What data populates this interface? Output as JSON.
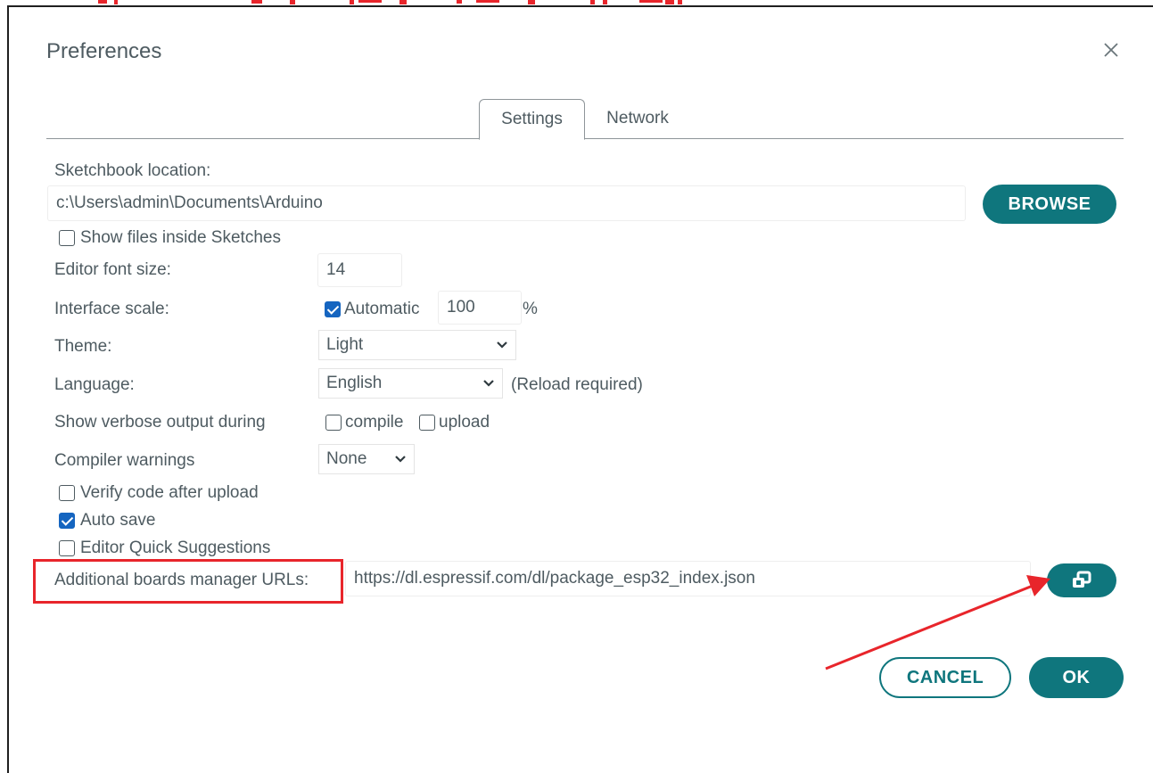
{
  "dialog": {
    "title": "Preferences",
    "tabs": [
      {
        "label": "Settings",
        "active": true
      },
      {
        "label": "Network",
        "active": false
      }
    ]
  },
  "settings": {
    "sketchbook_label": "Sketchbook location:",
    "sketchbook_value": "c:\\Users\\admin\\Documents\\Arduino",
    "browse_label": "BROWSE",
    "show_files_label": "Show files inside Sketches",
    "show_files_checked": false,
    "font_size_label": "Editor font size:",
    "font_size_value": "14",
    "scale_label": "Interface scale:",
    "scale_auto_label": "Automatic",
    "scale_auto_checked": true,
    "scale_value": "100",
    "scale_unit": "%",
    "theme_label": "Theme:",
    "theme_value": "Light",
    "language_label": "Language:",
    "language_value": "English",
    "language_note": "(Reload required)",
    "verbose_label": "Show verbose output during",
    "verbose_compile_label": "compile",
    "verbose_compile_checked": false,
    "verbose_upload_label": "upload",
    "verbose_upload_checked": false,
    "warnings_label": "Compiler warnings",
    "warnings_value": "None",
    "verify_label": "Verify code after upload",
    "verify_checked": false,
    "autosave_label": "Auto save",
    "autosave_checked": true,
    "quick_suggestions_label": "Editor Quick Suggestions",
    "quick_suggestions_checked": false,
    "boards_urls_label": "Additional boards manager URLs:",
    "boards_urls_value": "https://dl.espressif.com/dl/package_esp32_index.json"
  },
  "footer": {
    "cancel_label": "CANCEL",
    "ok_label": "OK"
  },
  "icons": {
    "close": "close-icon",
    "open_window": "open-window-icon",
    "chevron": "chevron-down-icon",
    "check": "checkmark"
  },
  "colors": {
    "accent": "#0f767d",
    "checkbox_checked": "#1565c0",
    "annotation_red": "#e8252b",
    "text": "#4e5b61"
  }
}
